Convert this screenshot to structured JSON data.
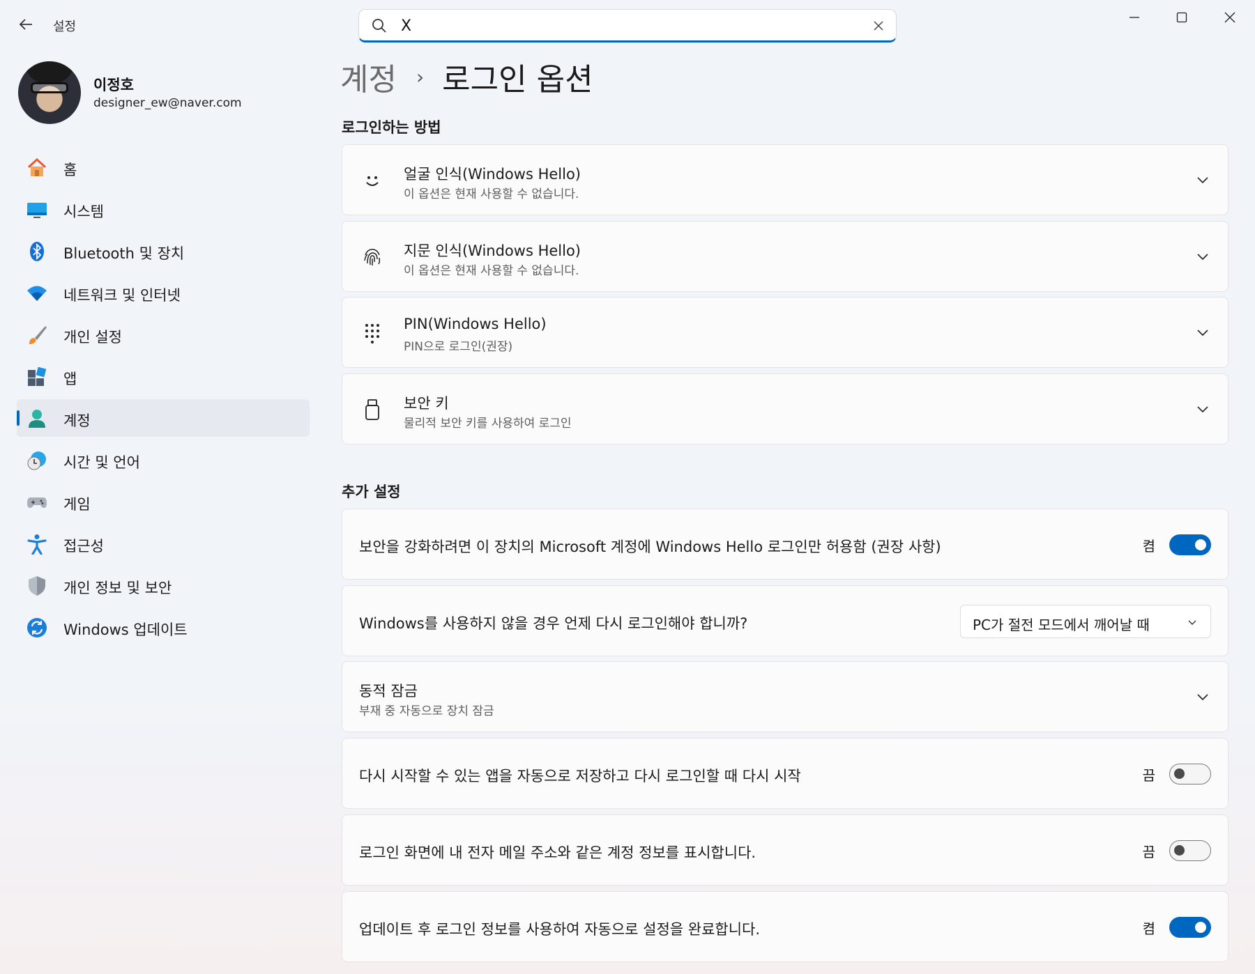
{
  "app": {
    "title": "설정"
  },
  "search": {
    "value": "X",
    "placeholder": ""
  },
  "user": {
    "name": "이정호",
    "email": "designer_ew@naver.com"
  },
  "sidebar": {
    "items": [
      {
        "label": "홈",
        "icon": "home-icon"
      },
      {
        "label": "시스템",
        "icon": "system-icon"
      },
      {
        "label": "Bluetooth 및 장치",
        "icon": "bluetooth-icon"
      },
      {
        "label": "네트워크 및 인터넷",
        "icon": "wifi-icon"
      },
      {
        "label": "개인 설정",
        "icon": "brush-icon"
      },
      {
        "label": "앱",
        "icon": "apps-icon"
      },
      {
        "label": "계정",
        "icon": "account-icon",
        "active": true
      },
      {
        "label": "시간 및 언어",
        "icon": "clock-globe-icon"
      },
      {
        "label": "게임",
        "icon": "gamepad-icon"
      },
      {
        "label": "접근성",
        "icon": "accessibility-icon"
      },
      {
        "label": "개인 정보 및 보안",
        "icon": "shield-icon"
      },
      {
        "label": "Windows 업데이트",
        "icon": "update-icon"
      }
    ]
  },
  "breadcrumb": {
    "parent": "계정",
    "separator": "›",
    "current": "로그인 옵션"
  },
  "sections": {
    "sign_in_methods": {
      "title": "로그인하는 방법",
      "cards": [
        {
          "title": "얼굴 인식(Windows Hello)",
          "subtitle": "이 옵션은 현재 사용할 수 없습니다.",
          "icon": "face-icon"
        },
        {
          "title": "지문 인식(Windows Hello)",
          "subtitle": "이 옵션은 현재 사용할 수 없습니다.",
          "icon": "fingerprint-icon"
        },
        {
          "title": "PIN(Windows Hello)",
          "subtitle": "PIN으로 로그인(권장)",
          "icon": "keypad-icon"
        },
        {
          "title": "보안 키",
          "subtitle": "물리적 보안 키를 사용하여 로그인",
          "icon": "usb-key-icon"
        }
      ]
    },
    "additional": {
      "title": "추가 설정",
      "hello_only": {
        "label": "보안을 강화하려면 이 장치의 Microsoft 계정에 Windows Hello 로그인만 허용함 (권장 사항)",
        "state": "켬",
        "on": true
      },
      "require_signin": {
        "label": "Windows를 사용하지 않을 경우 언제 다시 로그인해야 합니까?",
        "selected": "PC가 절전 모드에서 깨어날 때"
      },
      "dynamic_lock": {
        "title": "동적 잠금",
        "subtitle": "부재 중 자동으로 장치 잠금"
      },
      "restart_apps": {
        "label": "다시 시작할 수 있는 앱을 자동으로 저장하고 다시 로그인할 때 다시 시작",
        "state": "끔",
        "on": false
      },
      "show_account": {
        "label": "로그인 화면에 내 전자 메일 주소와 같은 계정 정보를 표시합니다.",
        "state": "끔",
        "on": false
      },
      "auto_finish": {
        "label": "업데이트 후 로그인 정보를 사용하여 자동으로 설정을 완료합니다.",
        "state": "켬",
        "on": true
      }
    }
  },
  "colors": {
    "accent": "#0067c0",
    "background": "#f1f4f9",
    "card": "#fbfbfb"
  }
}
